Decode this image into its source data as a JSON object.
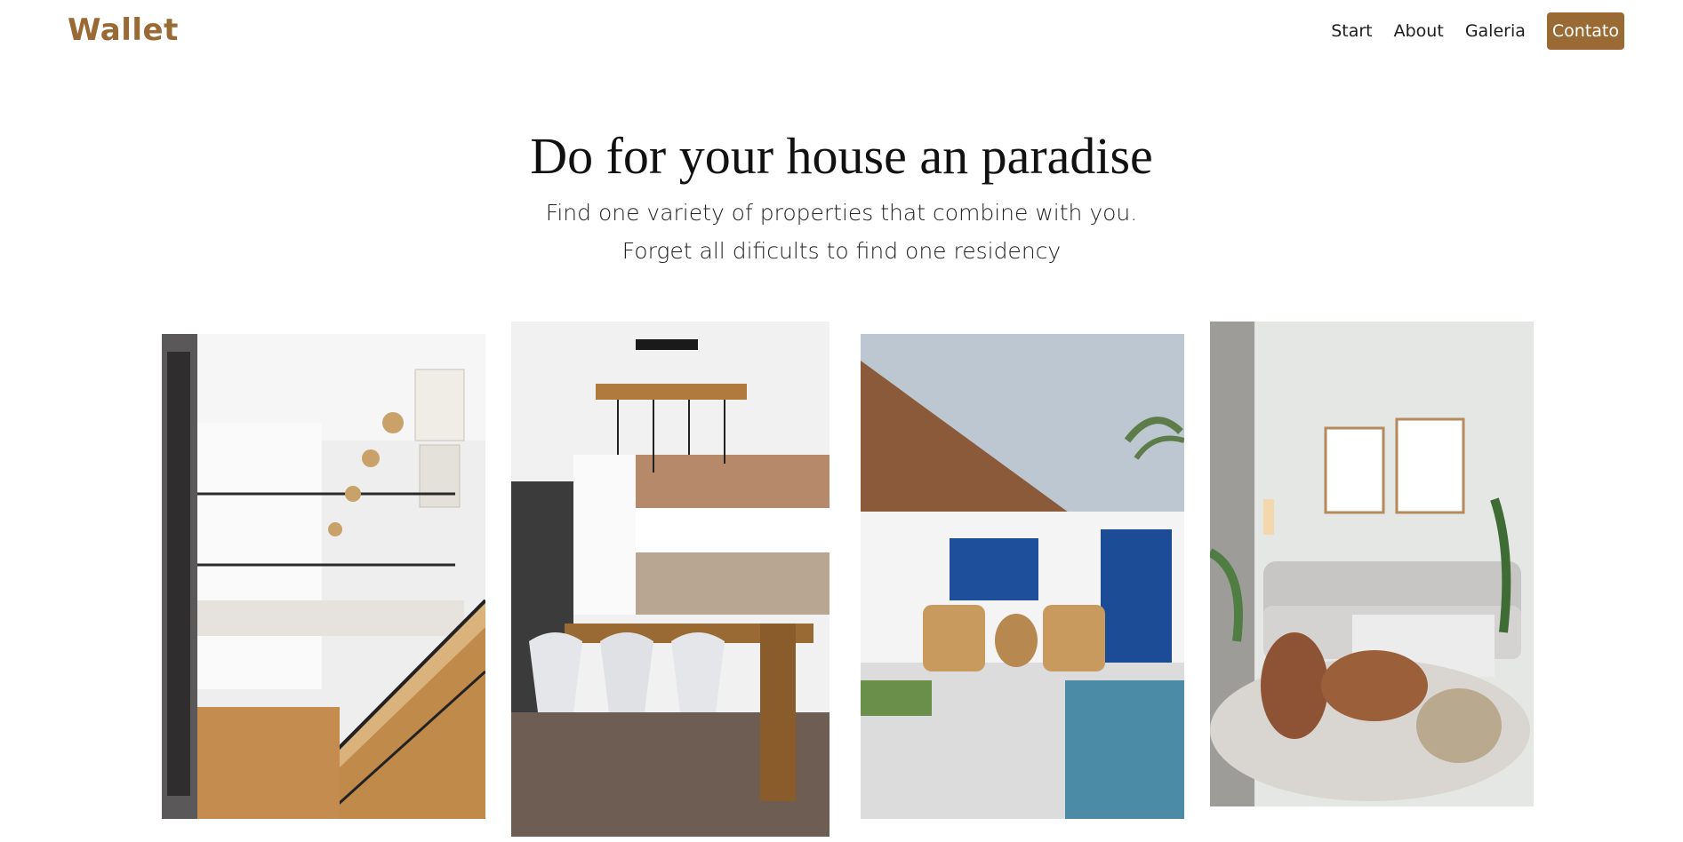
{
  "header": {
    "logo": "Wallet",
    "nav": {
      "start": "Start",
      "about": "About",
      "galeria": "Galeria",
      "contato": "Contato"
    }
  },
  "hero": {
    "title": "Do for your house an paradise",
    "subtitle_line1": "Find one variety of properties that combine with you.",
    "subtitle_line2": "Forget all dificults to find one residency"
  },
  "gallery": {
    "images": [
      {
        "name": "staircase-photo",
        "alt": ""
      },
      {
        "name": "dining-kitchen-photo",
        "alt": ""
      },
      {
        "name": "patio-pool-photo",
        "alt": ""
      },
      {
        "name": "living-room-photo",
        "alt": ""
      }
    ]
  },
  "colors": {
    "brand": "#9a6a35",
    "text": "#1d1d1d"
  }
}
